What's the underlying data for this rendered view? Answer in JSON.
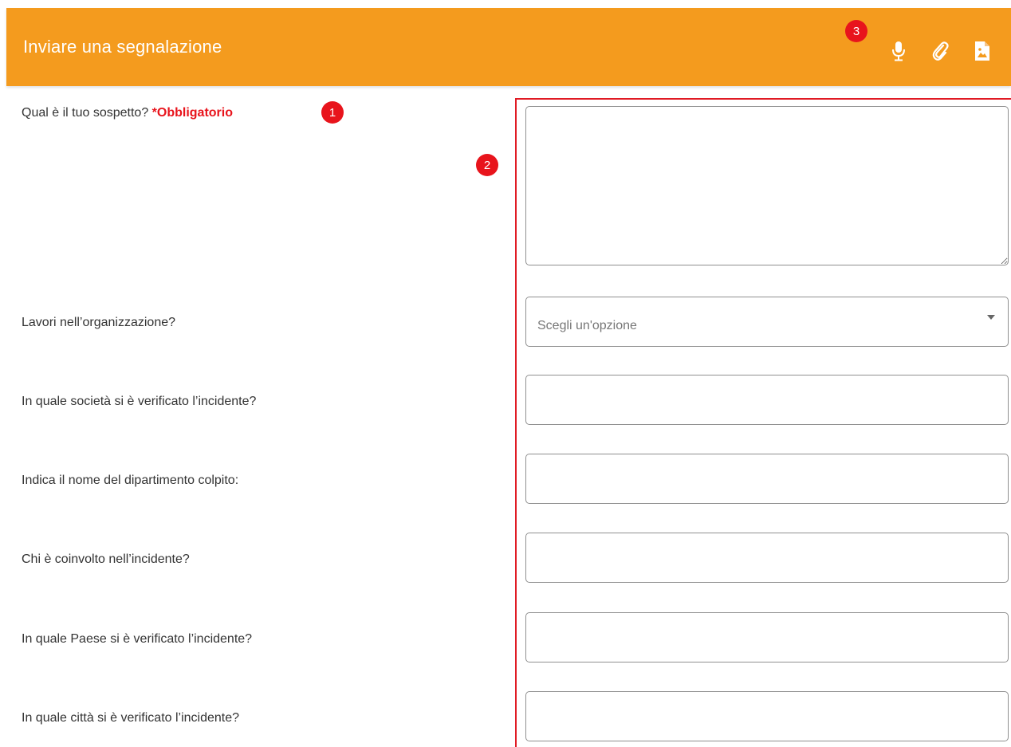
{
  "header": {
    "title": "Inviare una segnalazione",
    "badge": "3",
    "icons": [
      "microphone-icon",
      "paperclip-icon",
      "image-file-icon"
    ]
  },
  "form": {
    "q1": {
      "label": "Qual è il tuo sospetto?",
      "required_label": "*Obbligatorio",
      "badge": "1",
      "value": ""
    },
    "area_badge": "2",
    "q2": {
      "label": "Lavori nell’organizzazione?",
      "placeholder": "Scegli un'opzione"
    },
    "q3": {
      "label": "In quale società si è verificato l’incidente?",
      "value": ""
    },
    "q4": {
      "label": "Indica il nome del dipartimento colpito:",
      "value": ""
    },
    "q5": {
      "label": "Chi è coinvolto nell’incidente?",
      "value": ""
    },
    "q6": {
      "label": "In quale Paese si è verificato l’incidente?",
      "value": ""
    },
    "q7": {
      "label": "In quale città si è verificato l’incidente?",
      "value": ""
    }
  },
  "colors": {
    "header_bg": "#f49b1e",
    "badge_red": "#e8141c",
    "frame_red": "#e01b24"
  }
}
